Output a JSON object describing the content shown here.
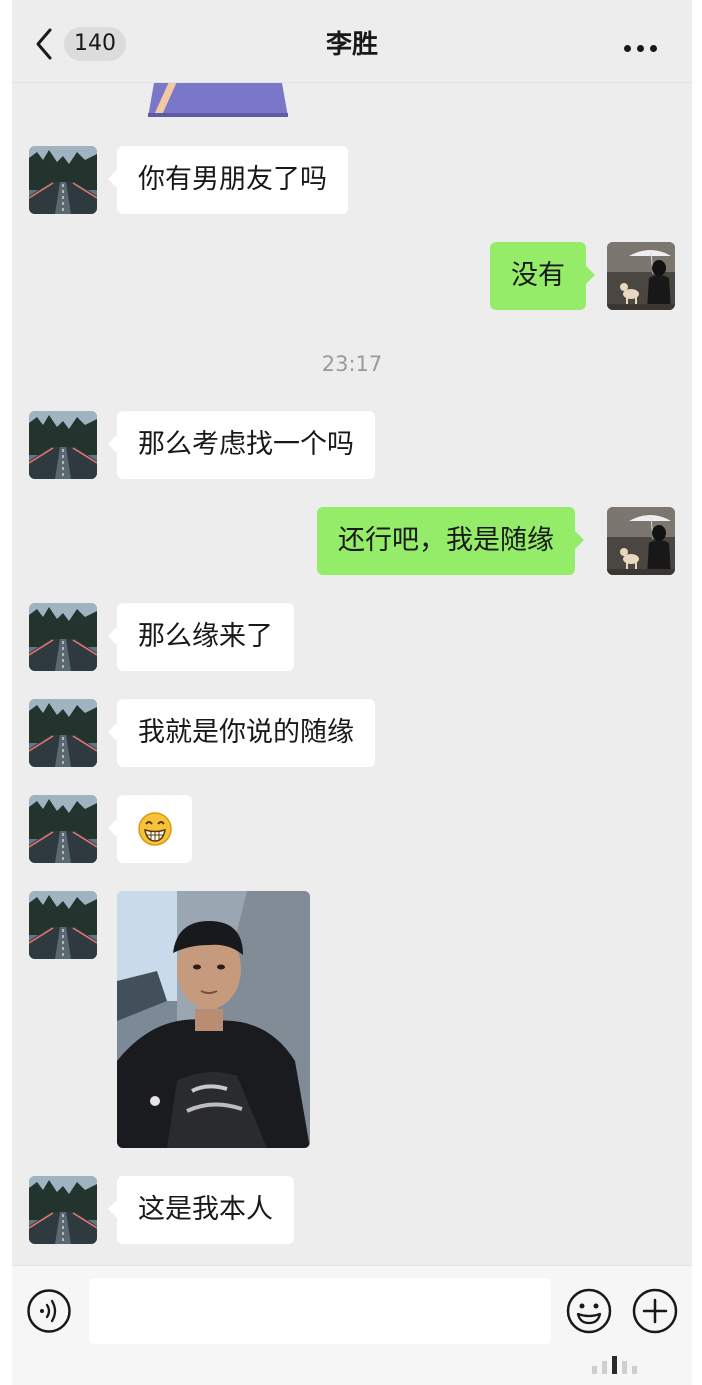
{
  "header": {
    "back_count": "140",
    "title": "李胜"
  },
  "messages": [
    {
      "side": "left",
      "text": "你有男朋友了吗"
    },
    {
      "side": "right",
      "text": "没有"
    },
    {
      "timestamp": "23:17"
    },
    {
      "side": "left",
      "text": "那么考虑找一个吗"
    },
    {
      "side": "right",
      "text": "还行吧，我是随缘"
    },
    {
      "side": "left",
      "text": "那么缘来了"
    },
    {
      "side": "left",
      "text": "我就是你说的随缘"
    },
    {
      "side": "left",
      "emoji": "grinning-face"
    },
    {
      "side": "left",
      "image": "selfie-photo"
    },
    {
      "side": "left",
      "text": "这是我本人"
    }
  ],
  "chat": {
    "msg1": "你有男朋友了吗",
    "msg2": "没有",
    "time": "23:17",
    "msg3": "那么考虑找一个吗",
    "msg4": "还行吧，我是随缘",
    "msg5": "那么缘来了",
    "msg6": "我就是你说的随缘",
    "msg9": "这是我本人"
  },
  "input": {
    "value": "",
    "placeholder": ""
  },
  "icons": [
    "back-arrow-icon",
    "more-icon",
    "voice-icon",
    "emoji-icon",
    "plus-icon"
  ],
  "colors": {
    "background": "#ededed",
    "sent_bubble": "#95ec69",
    "received_bubble": "#ffffff",
    "timestamp": "#9a9a9a"
  }
}
